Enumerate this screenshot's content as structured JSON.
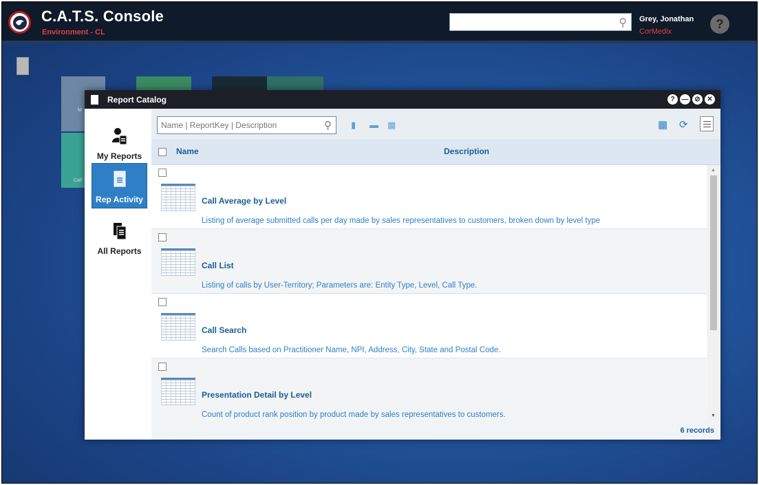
{
  "app": {
    "title": "C.A.T.S. Console",
    "environment": "Environment - CL",
    "search_placeholder": "",
    "user_name": "Grey, Jonathan",
    "user_org": "CorMedix",
    "help_label": "?"
  },
  "background_tiles": {
    "tile1_label": "M",
    "tile5_label": "Call"
  },
  "dialog": {
    "title": "Report Catalog",
    "nav": [
      {
        "label": "My Reports",
        "icon": "user-report-icon"
      },
      {
        "label": "Rep Activity",
        "icon": "document-list-icon",
        "active": true
      },
      {
        "label": "All Reports",
        "icon": "stacked-reports-icon"
      }
    ],
    "search_placeholder": "Name | ReportKey | Description",
    "columns": {
      "name": "Name",
      "description": "Description"
    },
    "reports": [
      {
        "name": "Call Average by Level",
        "description": "Listing of average submitted calls per day made by sales representatives to customers, broken down by level type"
      },
      {
        "name": "Call List",
        "description": "Listing of calls by User-Territory; Parameters are: Entity Type, Level, Call Type."
      },
      {
        "name": "Call Search",
        "description": "Search Calls based on Practitioner Name, NPI, Address, City, State and Postal Code."
      },
      {
        "name": "Presentation Detail by Level",
        "description": "Count of product rank position by product made by sales representatives to customers."
      }
    ],
    "record_count": "6 records"
  },
  "colors": {
    "header_bg": "#0f1a2b",
    "accent_blue": "#2f7fc6",
    "env_red": "#e04040",
    "link_blue": "#1a5d99"
  }
}
